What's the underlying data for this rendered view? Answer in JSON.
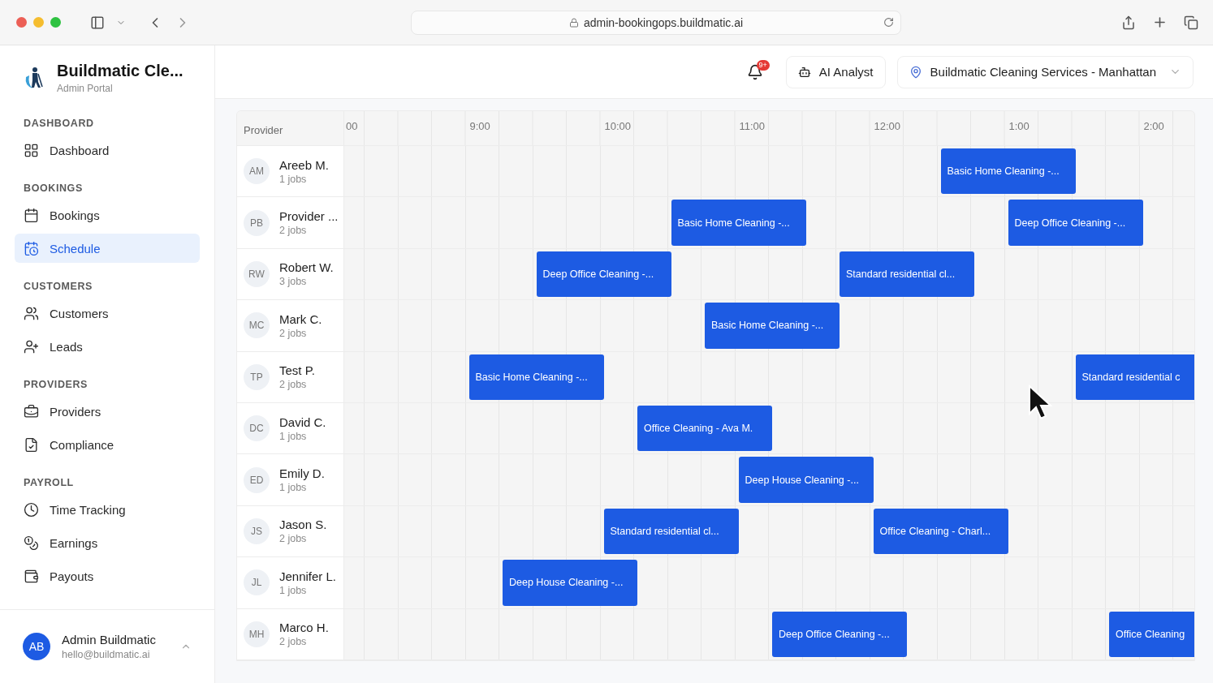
{
  "browser": {
    "url": "admin-bookingops.buildmatic.ai"
  },
  "sidebar": {
    "brand": {
      "name": "Buildmatic Cle...",
      "subtitle": "Admin Portal"
    },
    "sections": [
      {
        "title": "DASHBOARD",
        "items": [
          {
            "label": "Dashboard",
            "selected": false
          }
        ]
      },
      {
        "title": "BOOKINGS",
        "items": [
          {
            "label": "Bookings",
            "selected": false
          },
          {
            "label": "Schedule",
            "selected": true
          }
        ]
      },
      {
        "title": "CUSTOMERS",
        "items": [
          {
            "label": "Customers",
            "selected": false
          },
          {
            "label": "Leads",
            "selected": false
          }
        ]
      },
      {
        "title": "PROVIDERS",
        "items": [
          {
            "label": "Providers",
            "selected": false
          },
          {
            "label": "Compliance",
            "selected": false
          }
        ]
      },
      {
        "title": "PAYROLL",
        "items": [
          {
            "label": "Time Tracking",
            "selected": false
          },
          {
            "label": "Earnings",
            "selected": false
          },
          {
            "label": "Payouts",
            "selected": false
          }
        ]
      }
    ],
    "user": {
      "initials": "AB",
      "name": "Admin Buildmatic",
      "email": "hello@buildmatic.ai"
    }
  },
  "topbar": {
    "notifications_badge": "9+",
    "ai_button": "AI Analyst",
    "location": "Buildmatic Cleaning Services - Manhattan"
  },
  "schedule": {
    "provider_header": "Provider",
    "hours": [
      "00",
      "9:00",
      "10:00",
      "11:00",
      "12:00",
      "1:00",
      "2:00"
    ],
    "rows": [
      {
        "initials": "AM",
        "name": "Areeb M.",
        "jobs": "1 jobs",
        "slots": [
          {
            "booked": false
          },
          {
            "booked": false
          },
          {
            "booked": false
          },
          {
            "booked": false
          },
          {
            "booked": false
          },
          {
            "booked": false
          },
          {
            "booked": false
          },
          {
            "booked": false
          },
          {
            "booked": false
          },
          {
            "booked": false
          },
          {
            "booked": false
          },
          {
            "booked": false
          },
          {
            "booked": false
          },
          {
            "booked": false
          },
          {
            "booked": false
          },
          {
            "booked": false
          },
          {
            "booked": false
          },
          {
            "booked": false
          },
          {
            "booked": true,
            "title": "Basic Home Cleaning -..."
          }
        ]
      },
      {
        "initials": "PB",
        "name": "Provider ...",
        "jobs": "2 jobs",
        "slots": [
          {
            "booked": false
          },
          {
            "booked": false
          },
          {
            "booked": false
          },
          {
            "booked": false
          },
          {
            "booked": false
          },
          {
            "booked": false
          },
          {
            "booked": false
          },
          {
            "booked": false
          },
          {
            "booked": false
          },
          {
            "booked": false
          },
          {
            "booked": true,
            "title": "Basic Home Cleaning -..."
          },
          {
            "booked": false
          },
          {
            "booked": false
          },
          {
            "booked": false
          },
          {
            "booked": false
          },
          {
            "booked": false
          },
          {
            "booked": false
          },
          {
            "booked": false
          },
          {
            "booked": false
          },
          {
            "booked": false
          },
          {
            "booked": true,
            "title": "Deep Office Cleaning -..."
          }
        ]
      },
      {
        "initials": "RW",
        "name": "Robert W.",
        "jobs": "3 jobs",
        "slots": [
          {
            "booked": false
          },
          {
            "booked": false
          },
          {
            "booked": false
          },
          {
            "booked": false
          },
          {
            "booked": false
          },
          {
            "booked": false
          },
          {
            "booked": true,
            "title": "Deep Office Cleaning -..."
          },
          {
            "booked": false
          },
          {
            "booked": false
          },
          {
            "booked": false
          },
          {
            "booked": false
          },
          {
            "booked": false
          },
          {
            "booked": false
          },
          {
            "booked": false
          },
          {
            "booked": false
          },
          {
            "booked": true,
            "title": "Standard residential cl..."
          }
        ]
      },
      {
        "initials": "MC",
        "name": "Mark C.",
        "jobs": "2 jobs",
        "slots": [
          {
            "booked": false
          },
          {
            "booked": false
          },
          {
            "booked": false
          },
          {
            "booked": false
          },
          {
            "booked": false
          },
          {
            "booked": false
          },
          {
            "booked": false
          },
          {
            "booked": false
          },
          {
            "booked": false
          },
          {
            "booked": false
          },
          {
            "booked": false
          },
          {
            "booked": true,
            "title": "Basic Home Cleaning -..."
          }
        ]
      },
      {
        "initials": "TP",
        "name": "Test P.",
        "jobs": "2 jobs",
        "slots": [
          {
            "booked": false
          },
          {
            "booked": false
          },
          {
            "booked": false
          },
          {
            "booked": false
          },
          {
            "booked": true,
            "title": "Basic Home Cleaning -..."
          },
          {
            "booked": false
          },
          {
            "booked": false
          },
          {
            "booked": false
          },
          {
            "booked": false
          },
          {
            "booked": false
          },
          {
            "booked": false
          },
          {
            "booked": false
          },
          {
            "booked": false
          },
          {
            "booked": false
          },
          {
            "booked": false
          },
          {
            "booked": false
          },
          {
            "booked": false
          },
          {
            "booked": false
          },
          {
            "booked": false
          },
          {
            "booked": false
          },
          {
            "booked": false
          },
          {
            "booked": false
          },
          {
            "booked": true,
            "title": "Standard residential c"
          }
        ]
      },
      {
        "initials": "DC",
        "name": "David C.",
        "jobs": "1 jobs",
        "slots": [
          {
            "booked": false
          },
          {
            "booked": false
          },
          {
            "booked": false
          },
          {
            "booked": false
          },
          {
            "booked": false
          },
          {
            "booked": false
          },
          {
            "booked": false
          },
          {
            "booked": false
          },
          {
            "booked": false
          },
          {
            "booked": true,
            "title": "Office Cleaning - Ava M."
          }
        ]
      },
      {
        "initials": "ED",
        "name": "Emily D.",
        "jobs": "1 jobs",
        "slots": [
          {
            "booked": false
          },
          {
            "booked": false
          },
          {
            "booked": false
          },
          {
            "booked": false
          },
          {
            "booked": false
          },
          {
            "booked": false
          },
          {
            "booked": false
          },
          {
            "booked": false
          },
          {
            "booked": false
          },
          {
            "booked": false
          },
          {
            "booked": false
          },
          {
            "booked": false
          },
          {
            "booked": true,
            "title": "Deep House Cleaning -..."
          }
        ]
      },
      {
        "initials": "JS",
        "name": "Jason S.",
        "jobs": "2 jobs",
        "slots": [
          {
            "booked": false
          },
          {
            "booked": false
          },
          {
            "booked": false
          },
          {
            "booked": false
          },
          {
            "booked": false
          },
          {
            "booked": false
          },
          {
            "booked": false
          },
          {
            "booked": false
          },
          {
            "booked": true,
            "title": "Standard residential cl..."
          },
          {
            "booked": false
          },
          {
            "booked": false
          },
          {
            "booked": false
          },
          {
            "booked": false
          },
          {
            "booked": false
          },
          {
            "booked": false
          },
          {
            "booked": false
          },
          {
            "booked": true,
            "title": "Office Cleaning - Charl..."
          }
        ]
      },
      {
        "initials": "JL",
        "name": "Jennifer L.",
        "jobs": "1 jobs",
        "slots": [
          {
            "booked": false
          },
          {
            "booked": false
          },
          {
            "booked": false
          },
          {
            "booked": false
          },
          {
            "booked": false
          },
          {
            "booked": true,
            "title": "Deep House Cleaning -..."
          }
        ]
      },
      {
        "initials": "MH",
        "name": "Marco H.",
        "jobs": "2 jobs",
        "slots": [
          {
            "booked": false
          },
          {
            "booked": false
          },
          {
            "booked": false
          },
          {
            "booked": false
          },
          {
            "booked": false
          },
          {
            "booked": false
          },
          {
            "booked": false
          },
          {
            "booked": false
          },
          {
            "booked": false
          },
          {
            "booked": false
          },
          {
            "booked": false
          },
          {
            "booked": false
          },
          {
            "booked": false
          },
          {
            "booked": true,
            "title": "Deep Office Cleaning -..."
          },
          {
            "booked": false
          },
          {
            "booked": false
          },
          {
            "booked": false
          },
          {
            "booked": false
          },
          {
            "booked": false
          },
          {
            "booked": false
          },
          {
            "booked": false
          },
          {
            "booked": false
          },
          {
            "booked": false
          },
          {
            "booked": true,
            "title": "Office Cleaning"
          }
        ]
      }
    ]
  }
}
